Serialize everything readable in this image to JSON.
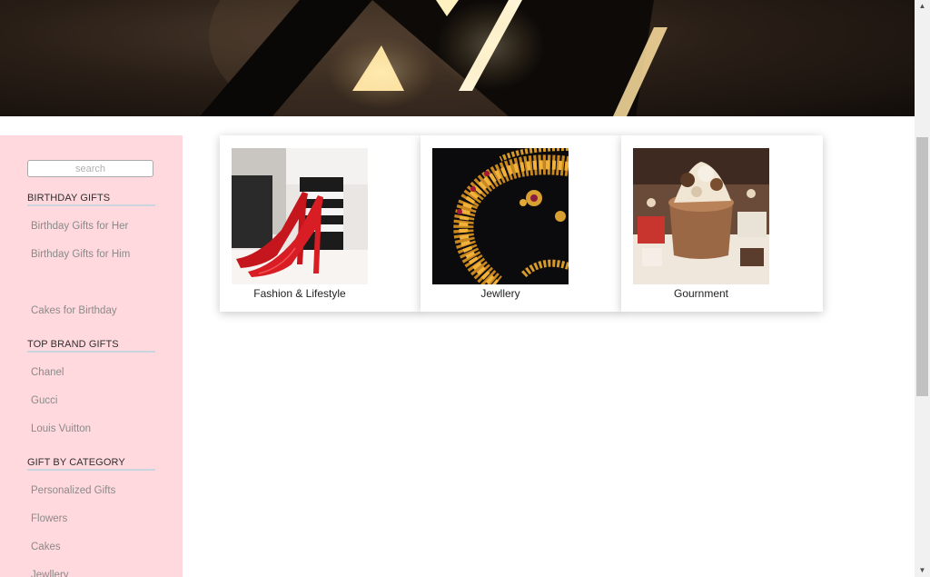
{
  "hero": {
    "image": "dark-wall-logo-light-photo"
  },
  "sidebar": {
    "search_placeholder": "search",
    "sections": [
      {
        "heading": "BIRTHDAY GIFTS",
        "links": [
          "Birthday Gifts for Her",
          "Birthday Gifts for Him",
          "Cakes for Birthday"
        ]
      },
      {
        "heading": "TOP BRAND GIFTS",
        "links": [
          "Chanel",
          "Gucci",
          "Louis Vuitton"
        ]
      },
      {
        "heading": "GIFT BY CATEGORY",
        "links": [
          "Personalized Gifts",
          "Flowers",
          "Cakes",
          "Jewllery"
        ]
      }
    ]
  },
  "cards": [
    {
      "caption": "Fashion & Lifestyle",
      "image": "red-heels-photo"
    },
    {
      "caption": "Jewllery",
      "image": "gold-necklace-photo"
    },
    {
      "caption": "Gournment",
      "image": "chocolate-cake-photo"
    }
  ],
  "colors": {
    "sidebar_bg": "#ffd9de",
    "heading_underline": "#c9d6df",
    "link_text": "#8a8a8a"
  }
}
